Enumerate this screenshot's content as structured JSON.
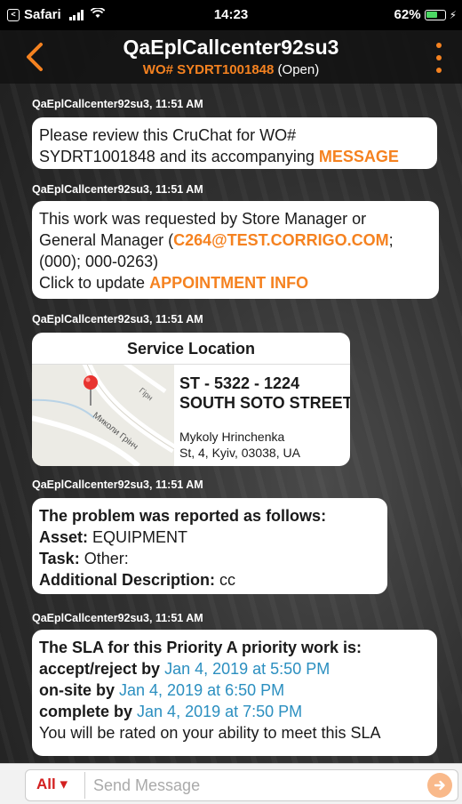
{
  "status_bar": {
    "back_app_label": "Safari",
    "time": "14:23",
    "battery": "62%",
    "battery_level": 0.62
  },
  "header": {
    "title": "QaEplCallcenter92su3",
    "wo_label": "WO# SYDRT1001848",
    "status": "(Open)"
  },
  "messages": [
    {
      "meta": "QaEplCallcenter92su3, 11:51 AM",
      "line1": "Please review this CruChat for WO#",
      "line2_text": "SYDRT1001848 and its accompanying ",
      "line2_link": "MESSAGE"
    },
    {
      "meta": "QaEplCallcenter92su3, 11:51 AM",
      "line1": "This work was requested by Store Manager or",
      "line2_text": "General Manager (",
      "line2_email": "C264@TEST.CORRIGO.COM",
      "line2_end": ";",
      "line3": "(000); 000-0263)",
      "line4_text": "Click to update ",
      "line4_link": "APPOINTMENT INFO"
    },
    {
      "meta": "QaEplCallcenter92su3, 11:51 AM",
      "card_title": "Service Location",
      "store": "ST - 5322 - 1224",
      "street": "SOUTH SOTO STREET",
      "addr1": "Mykoly Hrinchenka",
      "addr2": "St, 4, Kyiv,  03038, UA",
      "map_label": "Миколи Грінч",
      "map_label2": "Гірн"
    },
    {
      "meta": "QaEplCallcenter92su3, 11:51 AM",
      "heading": "The problem was reported as follows:",
      "asset_label": "Asset:",
      "asset_value": " EQUIPMENT",
      "task_label": "Task:",
      "task_value": " Other:",
      "desc_label": "Additional Description:",
      "desc_value": " cc"
    },
    {
      "meta": "QaEplCallcenter92su3, 11:51 AM",
      "heading": "The SLA for this Priority A priority work is:",
      "accept_label": "accept/reject by ",
      "accept_value": "Jan 4, 2019 at 5:50 PM",
      "onsite_label": "on-site by ",
      "onsite_value": "Jan 4, 2019 at 6:50 PM",
      "complete_label": "complete by ",
      "complete_value": "Jan 4, 2019 at 7:50 PM",
      "footer": "You will be rated on your ability to meet this SLA"
    }
  ],
  "composer": {
    "filter_label": "All ▾",
    "placeholder": "Send Message"
  },
  "colors": {
    "accent": "#f58220",
    "link_blue": "#2b8fc0",
    "filter_red": "#d32020"
  }
}
